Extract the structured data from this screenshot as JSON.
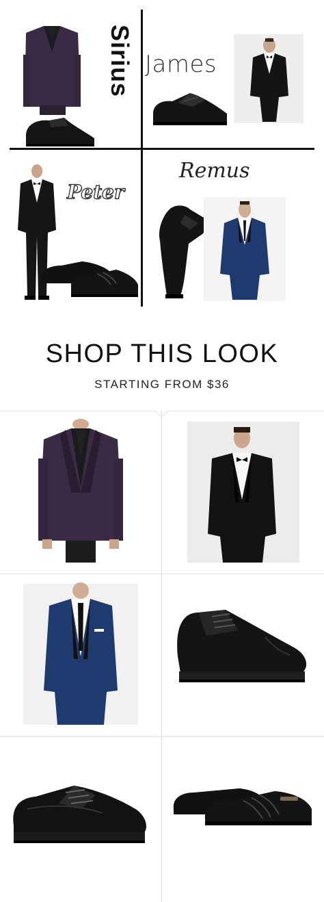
{
  "collage": {
    "names": {
      "sirius": "Sirius",
      "james": "James",
      "peter": "Peter",
      "remus": "Remus"
    }
  },
  "shop": {
    "title": "SHOP THIS LOOK",
    "subtitle": "STARTING FROM $36"
  },
  "products": [
    {
      "name": "purple-tuxedo-jacket"
    },
    {
      "name": "black-tuxedo-model"
    },
    {
      "name": "navy-tuxedo"
    },
    {
      "name": "black-cap-toe-oxford"
    },
    {
      "name": "black-lace-up-oxford"
    },
    {
      "name": "black-slip-on-shoe"
    }
  ],
  "colors": {
    "purple_suit": "#3a2a44",
    "navy_suit": "#1f3a6e",
    "black": "#111111",
    "background": "#ffffff",
    "grid_line": "#e2e2e2"
  }
}
